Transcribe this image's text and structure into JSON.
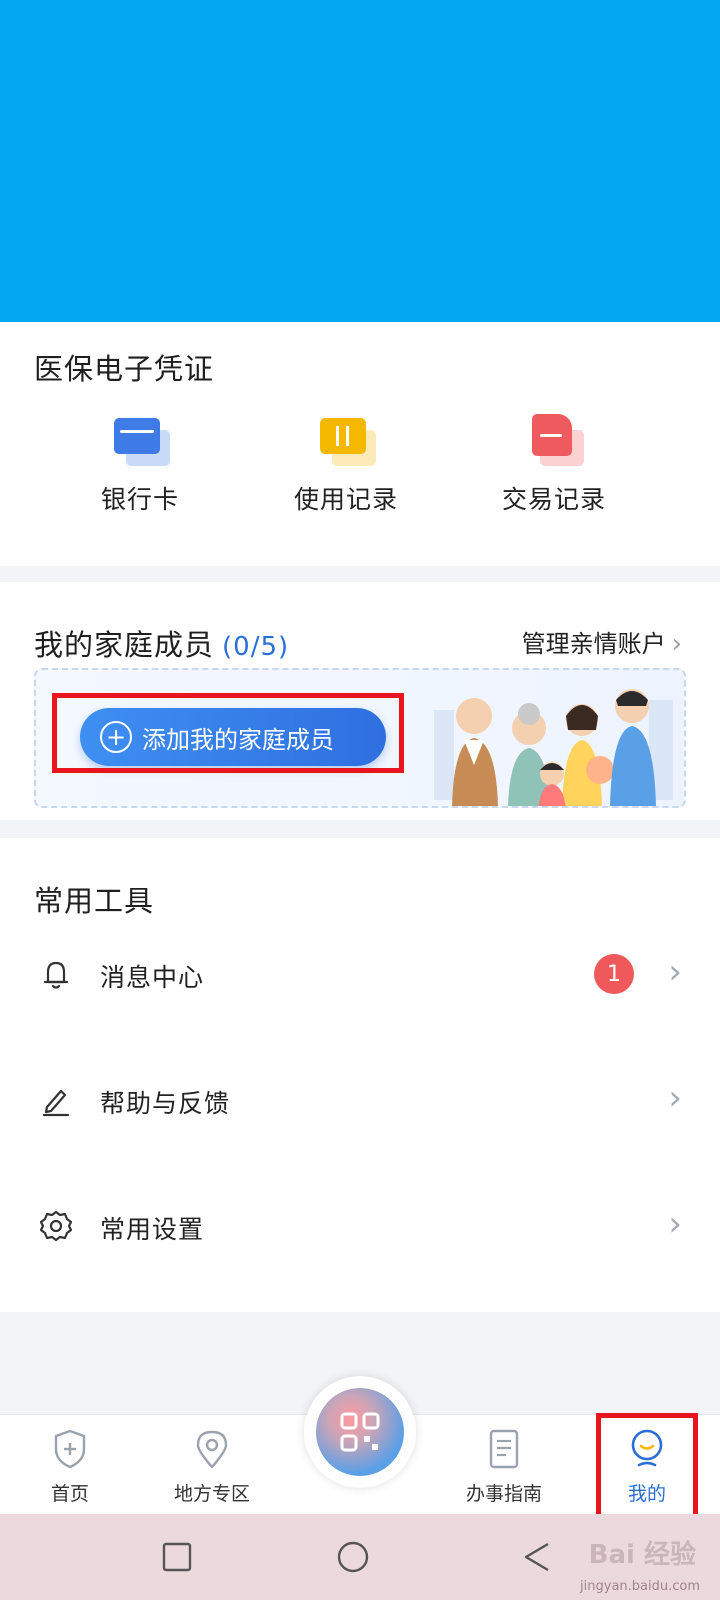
{
  "credentials": {
    "title": "医保电子凭证",
    "items": [
      {
        "label": "银行卡",
        "icon": "bank-card-icon",
        "color": "#3e7be6"
      },
      {
        "label": "使用记录",
        "icon": "usage-record-icon",
        "color": "#f5b800"
      },
      {
        "label": "交易记录",
        "icon": "transaction-record-icon",
        "color": "#ef5a5e"
      }
    ]
  },
  "family": {
    "title": "我的家庭成员",
    "count": "(0/5)",
    "manage_label": "管理亲情账户",
    "add_label": "添加我的家庭成员"
  },
  "tools": {
    "title": "常用工具",
    "items": [
      {
        "label": "消息中心",
        "icon": "bell-icon",
        "badge": "1"
      },
      {
        "label": "帮助与反馈",
        "icon": "pen-icon"
      },
      {
        "label": "常用设置",
        "icon": "gear-icon"
      }
    ]
  },
  "nav": {
    "items": [
      {
        "label": "首页",
        "icon": "shield-plus-icon"
      },
      {
        "label": "地方专区",
        "icon": "location-pin-icon"
      },
      {
        "label": "办事指南",
        "icon": "document-icon"
      },
      {
        "label": "我的",
        "icon": "user-smile-icon",
        "active": true
      }
    ],
    "scan_icon": "qr-code-icon"
  },
  "watermark": {
    "brand": "Bai 经验",
    "url": "jingyan.baidu.com"
  },
  "colors": {
    "hero": "#02a9f1",
    "accent_blue": "#2a6fd6",
    "highlight_red": "#e8141e",
    "badge_red": "#f0595c"
  }
}
